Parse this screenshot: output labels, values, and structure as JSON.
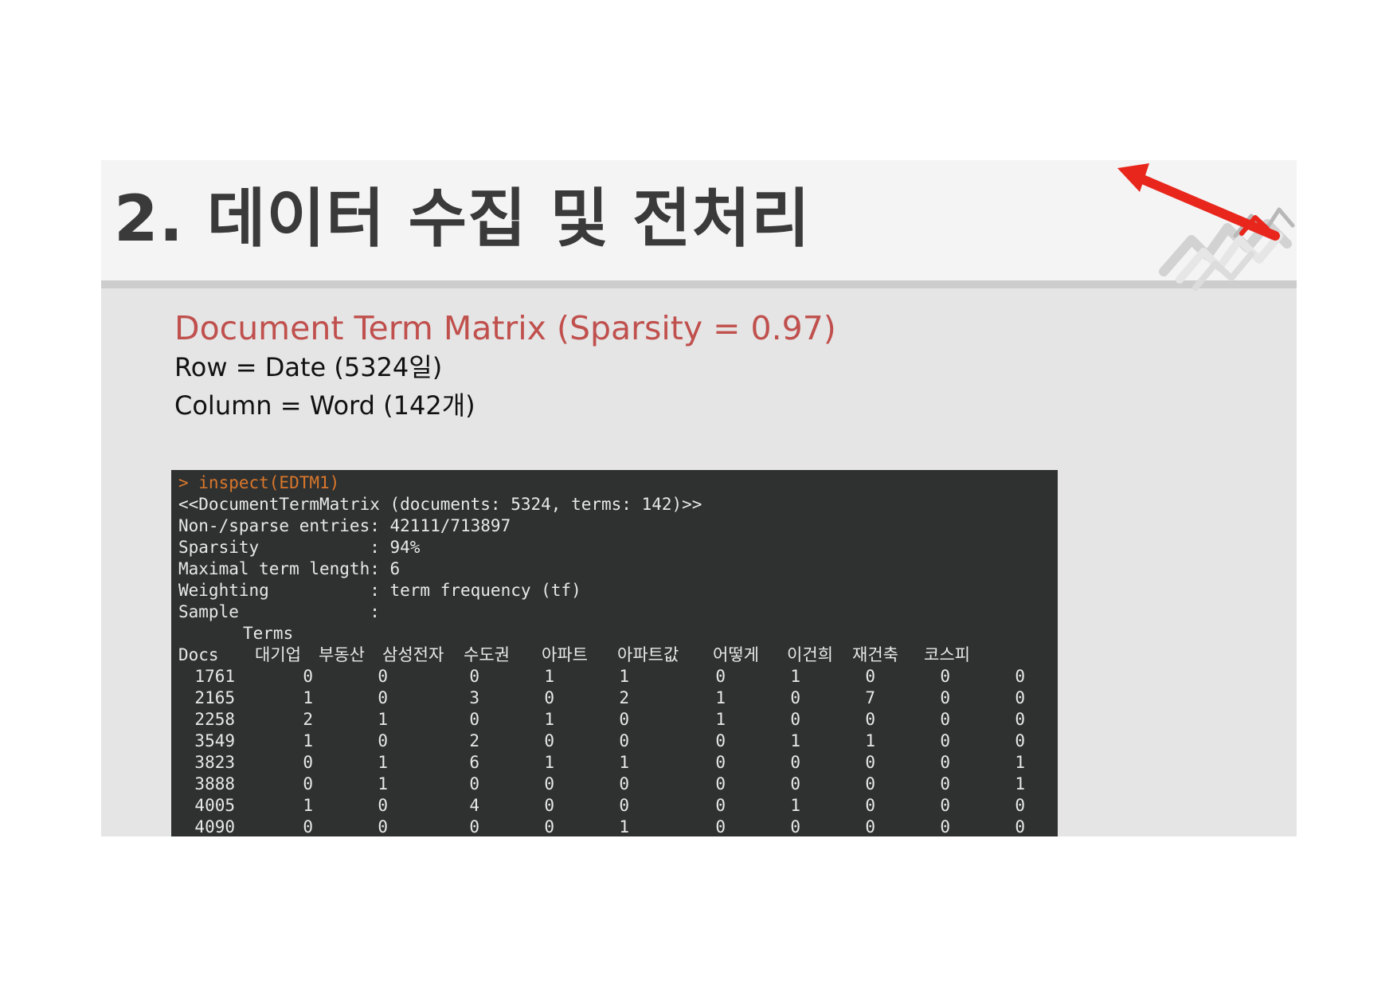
{
  "slide": {
    "title": "2. 데이터 수집 및 전처리",
    "heading": "Document Term Matrix (Sparsity = 0.97)",
    "row_info": "Row = Date (5324일)",
    "column_info": "Column = Word (142개)"
  },
  "colors": {
    "heading": "#c0504d",
    "title": "#3a3a3a",
    "console_bg": "#2f3030",
    "console_cmd": "#d9772b",
    "logo_arrow": "#e8261c"
  },
  "console": {
    "command": "> inspect(EDTM1)",
    "summary": [
      "<<DocumentTermMatrix (documents: 5324, terms: 142)>>",
      "Non-/sparse entries: 42111/713897",
      "Sparsity           : 94%",
      "Maximal term length: 6",
      "Weighting          : term frequency (tf)",
      "Sample             :"
    ],
    "terms_label": "Terms",
    "docs_label": "Docs",
    "terms": [
      "대기업",
      "부동산",
      "삼성전자",
      "수도권",
      "아파트",
      "아파트값",
      "어떻게",
      "이건희",
      "재건축",
      "코스피"
    ],
    "rows": [
      {
        "doc": "1761",
        "values": [
          "0",
          "0",
          "0",
          "1",
          "1",
          "0",
          "1",
          "0",
          "0",
          "0"
        ]
      },
      {
        "doc": "2165",
        "values": [
          "1",
          "0",
          "3",
          "0",
          "2",
          "1",
          "0",
          "7",
          "0",
          "0"
        ]
      },
      {
        "doc": "2258",
        "values": [
          "2",
          "1",
          "0",
          "1",
          "0",
          "1",
          "0",
          "0",
          "0",
          "0"
        ]
      },
      {
        "doc": "3549",
        "values": [
          "1",
          "0",
          "2",
          "0",
          "0",
          "0",
          "1",
          "1",
          "0",
          "0"
        ]
      },
      {
        "doc": "3823",
        "values": [
          "0",
          "1",
          "6",
          "1",
          "1",
          "0",
          "0",
          "0",
          "0",
          "1"
        ]
      },
      {
        "doc": "3888",
        "values": [
          "0",
          "1",
          "0",
          "0",
          "0",
          "0",
          "0",
          "0",
          "0",
          "1"
        ]
      },
      {
        "doc": "4005",
        "values": [
          "1",
          "0",
          "4",
          "0",
          "0",
          "0",
          "1",
          "0",
          "0",
          "0"
        ]
      },
      {
        "doc": "4090",
        "values": [
          "0",
          "0",
          "0",
          "0",
          "1",
          "0",
          "0",
          "0",
          "0",
          "0"
        ]
      }
    ]
  }
}
